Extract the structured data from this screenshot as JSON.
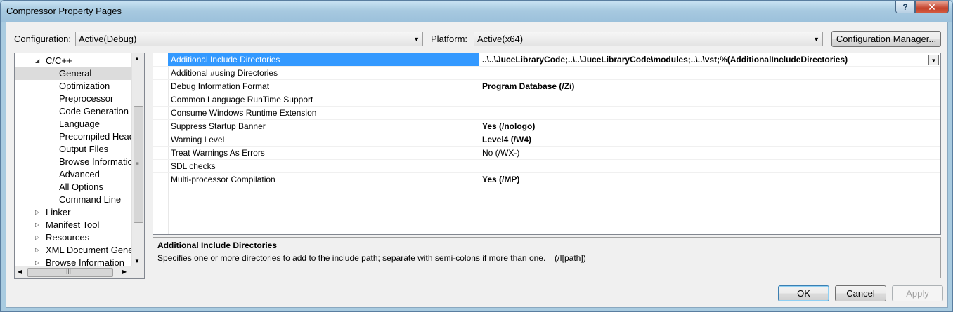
{
  "window": {
    "title": "Compressor Property Pages",
    "help": "?",
    "close": "✕"
  },
  "config": {
    "config_label": "Configuration:",
    "config_value": "Active(Debug)",
    "platform_label": "Platform:",
    "platform_value": "Active(x64)",
    "manager_button": "Configuration Manager..."
  },
  "tree": {
    "items": [
      {
        "label": "C/C++",
        "level": 1,
        "expander": "expanded"
      },
      {
        "label": "General",
        "level": 2,
        "selected": true
      },
      {
        "label": "Optimization",
        "level": 2
      },
      {
        "label": "Preprocessor",
        "level": 2
      },
      {
        "label": "Code Generation",
        "level": 2
      },
      {
        "label": "Language",
        "level": 2
      },
      {
        "label": "Precompiled Heade",
        "level": 2
      },
      {
        "label": "Output Files",
        "level": 2
      },
      {
        "label": "Browse Information",
        "level": 2
      },
      {
        "label": "Advanced",
        "level": 2
      },
      {
        "label": "All Options",
        "level": 2
      },
      {
        "label": "Command Line",
        "level": 2
      },
      {
        "label": "Linker",
        "level": 1,
        "expander": "collapsed"
      },
      {
        "label": "Manifest Tool",
        "level": 1,
        "expander": "collapsed"
      },
      {
        "label": "Resources",
        "level": 1,
        "expander": "collapsed"
      },
      {
        "label": "XML Document Genera",
        "level": 1,
        "expander": "collapsed"
      },
      {
        "label": "Browse Information",
        "level": 1,
        "expander": "collapsed"
      }
    ]
  },
  "grid": {
    "rows": [
      {
        "name": "Additional Include Directories",
        "value": "..\\..\\JuceLibraryCode;..\\..\\JuceLibraryCode\\modules;..\\..\\vst;%(AdditionalIncludeDirectories)",
        "bold": true,
        "selected": true
      },
      {
        "name": "Additional #using Directories",
        "value": "",
        "bold": false
      },
      {
        "name": "Debug Information Format",
        "value": "Program Database (/Zi)",
        "bold": true
      },
      {
        "name": "Common Language RunTime Support",
        "value": "",
        "bold": false
      },
      {
        "name": "Consume Windows Runtime Extension",
        "value": "",
        "bold": false
      },
      {
        "name": "Suppress Startup Banner",
        "value": "Yes (/nologo)",
        "bold": true
      },
      {
        "name": "Warning Level",
        "value": "Level4 (/W4)",
        "bold": true
      },
      {
        "name": "Treat Warnings As Errors",
        "value": "No (/WX-)",
        "bold": false
      },
      {
        "name": "SDL checks",
        "value": "",
        "bold": false
      },
      {
        "name": "Multi-processor Compilation",
        "value": "Yes (/MP)",
        "bold": true
      }
    ]
  },
  "description": {
    "title": "Additional Include Directories",
    "text": "Specifies one or more directories to add to the include path; separate with semi-colons if more than one.",
    "switch": "(/I[path])"
  },
  "buttons": {
    "ok": "OK",
    "cancel": "Cancel",
    "apply": "Apply"
  }
}
